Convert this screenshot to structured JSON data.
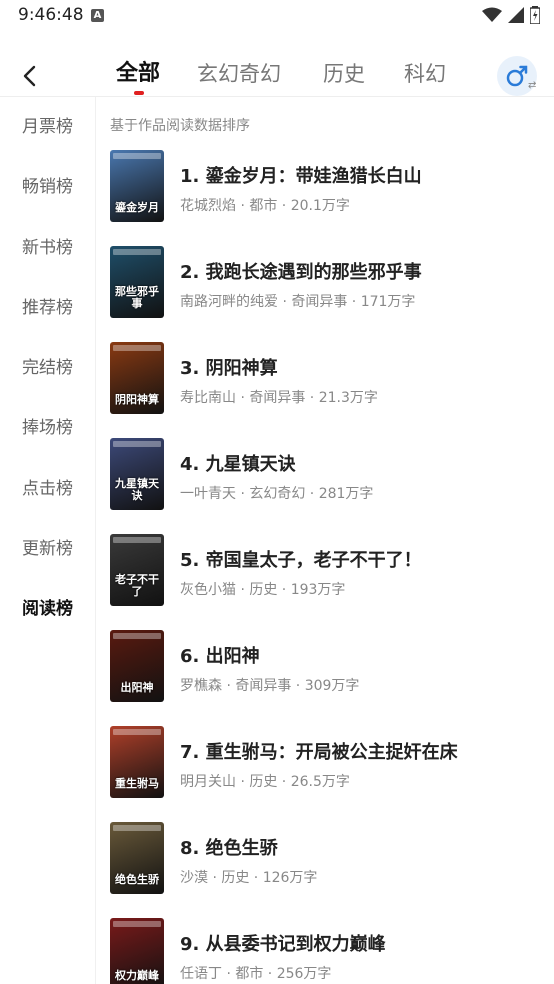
{
  "status_bar": {
    "time": "9:46:48",
    "notification_letter": "A"
  },
  "header": {
    "tabs": [
      {
        "label": "全部",
        "active": true
      },
      {
        "label": "玄幻奇幻",
        "active": false
      },
      {
        "label": "历史",
        "active": false
      },
      {
        "label": "科幻",
        "active": false
      }
    ],
    "gender_toggle": "male",
    "accent_color": "#e02020"
  },
  "sidebar": {
    "items": [
      {
        "label": "月票榜",
        "active": false
      },
      {
        "label": "畅销榜",
        "active": false
      },
      {
        "label": "新书榜",
        "active": false
      },
      {
        "label": "推荐榜",
        "active": false
      },
      {
        "label": "完结榜",
        "active": false
      },
      {
        "label": "捧场榜",
        "active": false
      },
      {
        "label": "点击榜",
        "active": false
      },
      {
        "label": "更新榜",
        "active": false
      },
      {
        "label": "阅读榜",
        "active": true
      }
    ]
  },
  "content": {
    "subtitle": "基于作品阅读数据排序",
    "books": [
      {
        "title": "1. 鎏金岁月：带娃渔猎长白山",
        "meta": "花城烈焰 · 都市 · 20.1万字",
        "cover_text": "鎏金岁月",
        "cover_color": "#4a78b0"
      },
      {
        "title": "2. 我跑长途遇到的那些邪乎事",
        "meta": "南路河畔的纯爱 · 奇闻异事 · 171万字",
        "cover_text": "那些邪乎事",
        "cover_color": "#1f4f6a"
      },
      {
        "title": "3. 阴阳神算",
        "meta": "寿比南山 · 奇闻异事 · 21.3万字",
        "cover_text": "阴阳神算",
        "cover_color": "#8a3a12"
      },
      {
        "title": "4. 九星镇天诀",
        "meta": "一叶青天 · 玄幻奇幻 · 281万字",
        "cover_text": "九星镇天诀",
        "cover_color": "#3d4a7a"
      },
      {
        "title": "5. 帝国皇太子，老子不干了！",
        "meta": "灰色小猫 · 历史 · 193万字",
        "cover_text": "老子不干了",
        "cover_color": "#3a3a3a"
      },
      {
        "title": "6. 出阳神",
        "meta": "罗樵森 · 奇闻异事 · 309万字",
        "cover_text": "出阳神",
        "cover_color": "#5a1a10"
      },
      {
        "title": "7. 重生驸马：开局被公主捉奸在床",
        "meta": "明月关山 · 历史 · 26.5万字",
        "cover_text": "重生驸马",
        "cover_color": "#b0402a"
      },
      {
        "title": "8. 绝色生骄",
        "meta": "沙漠 · 历史 · 126万字",
        "cover_text": "绝色生骄",
        "cover_color": "#6a5a3a"
      },
      {
        "title": "9. 从县委书记到权力巅峰",
        "meta": "任语丁 · 都市 · 256万字",
        "cover_text": "权力巅峰",
        "cover_color": "#7a1a1a"
      }
    ]
  }
}
